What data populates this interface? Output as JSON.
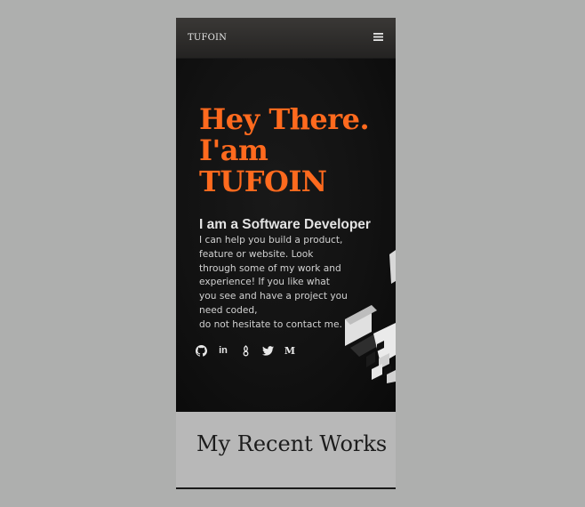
{
  "navbar": {
    "brand": "TUFOIN",
    "menu_icon": "hamburger-icon"
  },
  "hero": {
    "headline": "Hey There.\nI'am\nTUFOIN",
    "subtitle": "I am a Software Developer",
    "bio": "I can help you build a product,\nfeature or website. Look\nthrough some of my work and\nexperience! If you like what\nyou see and have a project you\nneed coded,\ndo not hesitate to contact me.",
    "accent_color": "#ff6a1e",
    "social_icons": [
      "github-icon",
      "linkedin-icon",
      "codechef-icon",
      "twitter-icon",
      "medium-icon"
    ],
    "social_medium_glyph": "M"
  },
  "works": {
    "title": "My Recent Works"
  }
}
